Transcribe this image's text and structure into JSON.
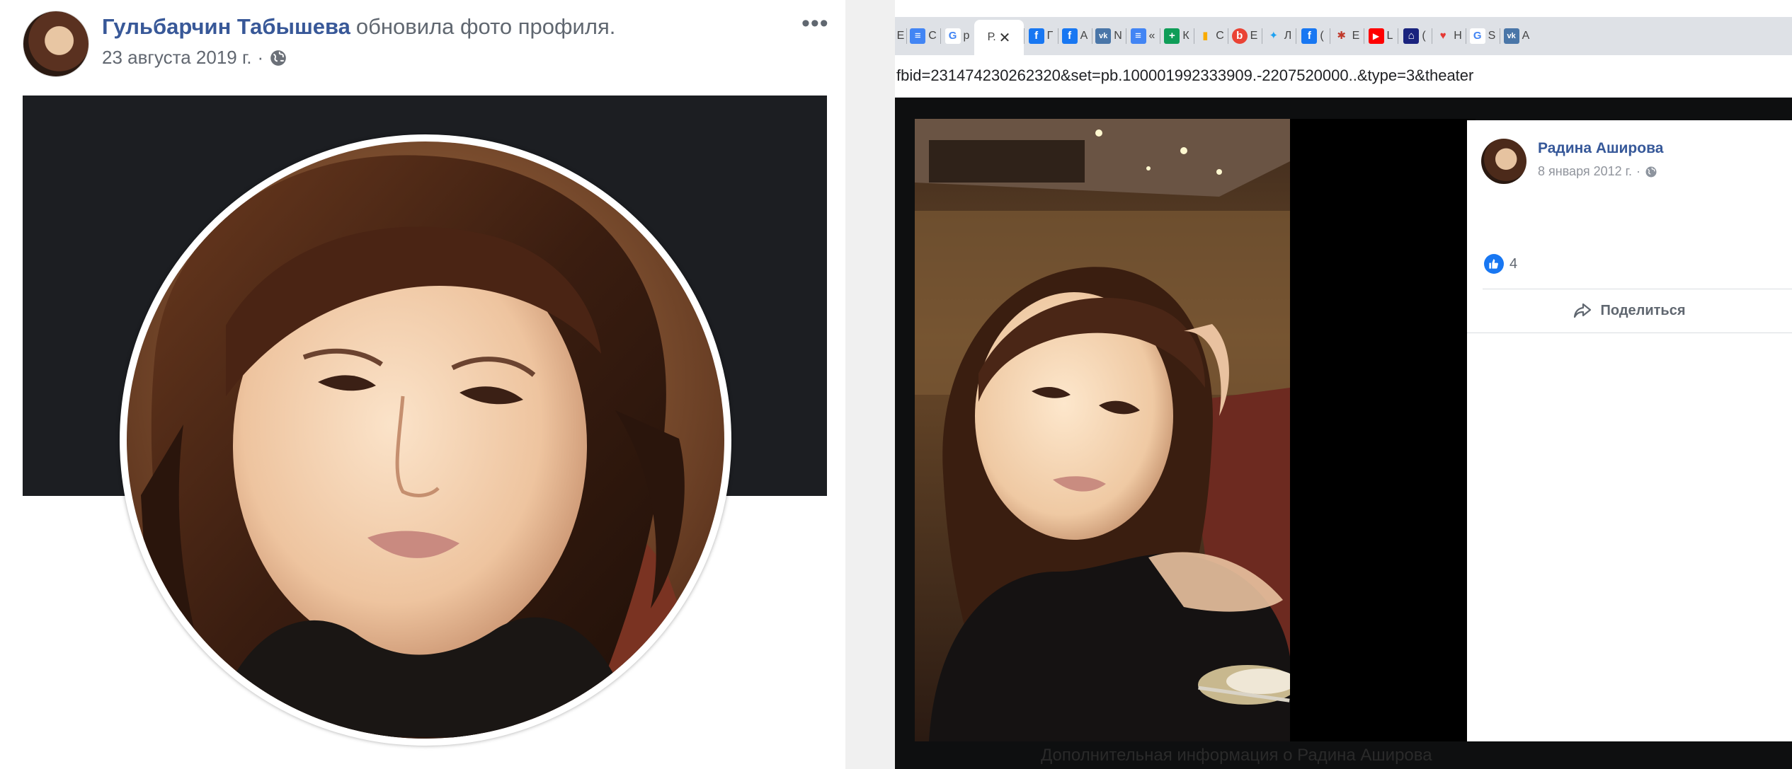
{
  "post": {
    "author": "Гульбарчин Табышева",
    "action": "обновила фото профиля.",
    "date": "23 августа 2019 г.",
    "separator": "·",
    "more_label": "•••"
  },
  "browser": {
    "active_tab_label": "Р.",
    "active_tab_close": "✕",
    "tabs": [
      {
        "icon": "docs-icon",
        "letter": "С",
        "color": "#4285f4"
      },
      {
        "icon": "google-icon",
        "letter": "р",
        "color": "#ffffff"
      },
      {
        "icon": "facebook-icon",
        "letter": "Г",
        "color": "#1877f2"
      },
      {
        "icon": "facebook-icon",
        "letter": "А",
        "color": "#1877f2"
      },
      {
        "icon": "vk-icon",
        "letter": "N",
        "color": "#4a76a8"
      },
      {
        "icon": "docs-icon",
        "letter": "«",
        "color": "#4285f4"
      },
      {
        "icon": "sheets-icon",
        "letter": "К",
        "color": "#0f9d58"
      },
      {
        "icon": "analytics-icon",
        "letter": "С",
        "color": "#f9ab00"
      },
      {
        "icon": "orange-circle-icon",
        "letter": "Е",
        "color": "#ea4335"
      },
      {
        "icon": "twitter-icon",
        "letter": "Л",
        "color": "#1da1f2"
      },
      {
        "icon": "facebook-icon",
        "letter": "(",
        "color": "#1877f2"
      },
      {
        "icon": "bug-icon",
        "letter": "Е",
        "color": "#c0392b"
      },
      {
        "icon": "youtube-icon",
        "letter": "L",
        "color": "#ff0000"
      },
      {
        "icon": "house-icon",
        "letter": "(",
        "color": "#1a237e"
      },
      {
        "icon": "broken-heart-icon",
        "letter": "Н",
        "color": "#e53935"
      },
      {
        "icon": "google-icon",
        "letter": "S",
        "color": "#ffffff"
      },
      {
        "icon": "vk-icon",
        "letter": "А",
        "color": "#4a76a8"
      }
    ],
    "first_tab_letter": "Е",
    "url": "fbid=231474230262320&set=pb.100001992333909.-2207520000..&type=3&theater"
  },
  "theater": {
    "poster_name": "Радина Аширова",
    "poster_date": "8 января 2012 г.",
    "separator": "·",
    "like_count": "4",
    "share_label": "Поделиться",
    "footer_text": "Дополнительная информация о Радина Аширова"
  },
  "colors": {
    "fb_blue": "#385898",
    "like_blue": "#1877f2",
    "cover_dark": "#1c1e22",
    "theater_bg": "#0e0f10"
  }
}
